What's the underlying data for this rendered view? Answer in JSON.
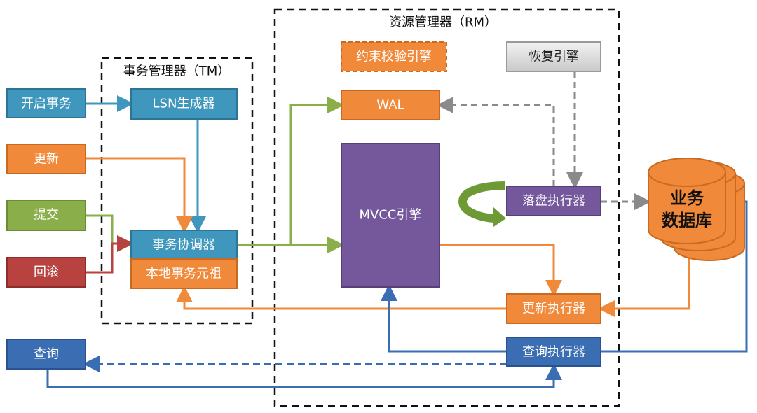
{
  "tm": {
    "title": "事务管理器（TM）"
  },
  "rm": {
    "title": "资源管理器（RM）"
  },
  "inputs": {
    "begin": "开启事务",
    "update": "更新",
    "commit": "提交",
    "rollback": "回滚",
    "query": "查询"
  },
  "tm_components": {
    "lsn": "LSN生成器",
    "coordinator": "事务协调器",
    "local_tuple": "本地事务元祖"
  },
  "rm_components": {
    "constraint": "约束校验引擎",
    "recovery": "恢复引擎",
    "wal": "WAL",
    "mvcc": "MVCC引擎",
    "flush": "落盘执行器",
    "update_exec": "更新执行器",
    "query_exec": "查询执行器"
  },
  "database": {
    "line1": "业务",
    "line2": "数据库"
  },
  "colors": {
    "teal": "#3f97bd",
    "orange": "#f0893a",
    "green": "#8aae4a",
    "red": "#b8423f",
    "blue": "#3b6db3",
    "purple": "#75579c",
    "grey": "#8a8a8a"
  }
}
